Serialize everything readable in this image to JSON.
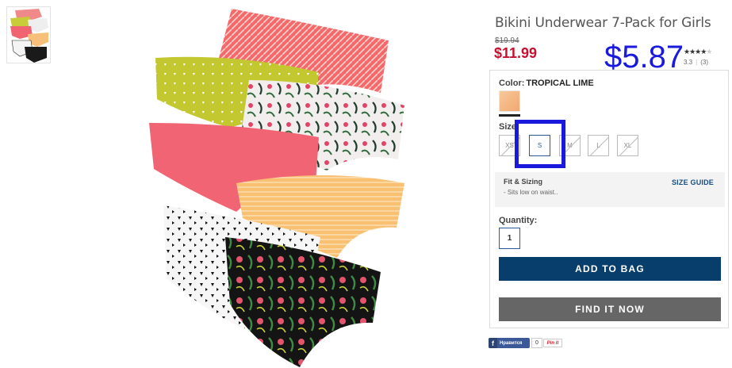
{
  "product": {
    "title": "Bikini Underwear 7-Pack for Girls",
    "old_price": "$19.94",
    "price": "$11.99",
    "rating_stars": "★★★★",
    "rating_off": "★",
    "rating_value": "3.3",
    "review_count": "(3)"
  },
  "overlay_price": "$5.87",
  "options": {
    "color_label": "Color:",
    "color_value": "TROPICAL LIME",
    "size_label": "Size",
    "sizes": [
      "XS",
      "S",
      "M",
      "L",
      "XL"
    ],
    "fit_title": "Fit & Sizing",
    "fit_desc": "- Sits low on waist..",
    "size_guide": "SIZE GUIDE",
    "quantity_label": "Quantity:",
    "quantity_value": "1"
  },
  "actions": {
    "add_to_bag": "ADD TO BAG",
    "find_it_now": "FIND IT NOW"
  },
  "social": {
    "fb_icon": "f",
    "fb_label": "Нравится",
    "fb_count": "0",
    "pin_label": "Pin it"
  },
  "colors": {
    "price_red": "#c8102e",
    "add_button": "#073e6c",
    "find_button": "#666666",
    "highlight_blue": "#1a1adf"
  }
}
